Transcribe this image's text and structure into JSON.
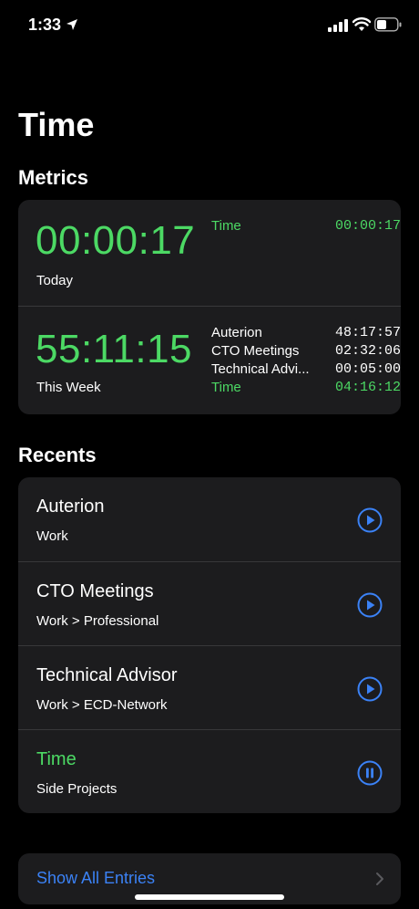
{
  "status_bar": {
    "time": "1:33"
  },
  "page_title": "Time",
  "metrics": {
    "section_title": "Metrics",
    "today": {
      "big_time": "00:00:17",
      "label": "Today",
      "breakdown": [
        {
          "name": "Time",
          "value": "00:00:17",
          "highlight": true
        }
      ]
    },
    "week": {
      "big_time": "55:11:15",
      "label": "This Week",
      "breakdown": [
        {
          "name": "Auterion",
          "value": "48:17:57",
          "highlight": false
        },
        {
          "name": "CTO Meetings",
          "value": "02:32:06",
          "highlight": false
        },
        {
          "name": "Technical Advi...",
          "value": "00:05:00",
          "highlight": false
        },
        {
          "name": "Time",
          "value": "04:16:12",
          "highlight": true
        }
      ]
    }
  },
  "recents": {
    "section_title": "Recents",
    "items": [
      {
        "name": "Auterion",
        "subtitle": "Work",
        "action_icon": "play-icon",
        "active": false
      },
      {
        "name": "CTO Meetings",
        "subtitle": "Work > Professional",
        "action_icon": "play-icon",
        "active": false
      },
      {
        "name": "Technical Advisor",
        "subtitle": "Work > ECD-Network",
        "action_icon": "play-icon",
        "active": false
      },
      {
        "name": "Time",
        "subtitle": "Side Projects",
        "action_icon": "pause-icon",
        "active": true
      }
    ]
  },
  "show_all": {
    "label": "Show All Entries"
  },
  "colors": {
    "accent_green": "#4cd964",
    "accent_blue": "#3b82f6",
    "card_bg": "#1c1c1e"
  }
}
